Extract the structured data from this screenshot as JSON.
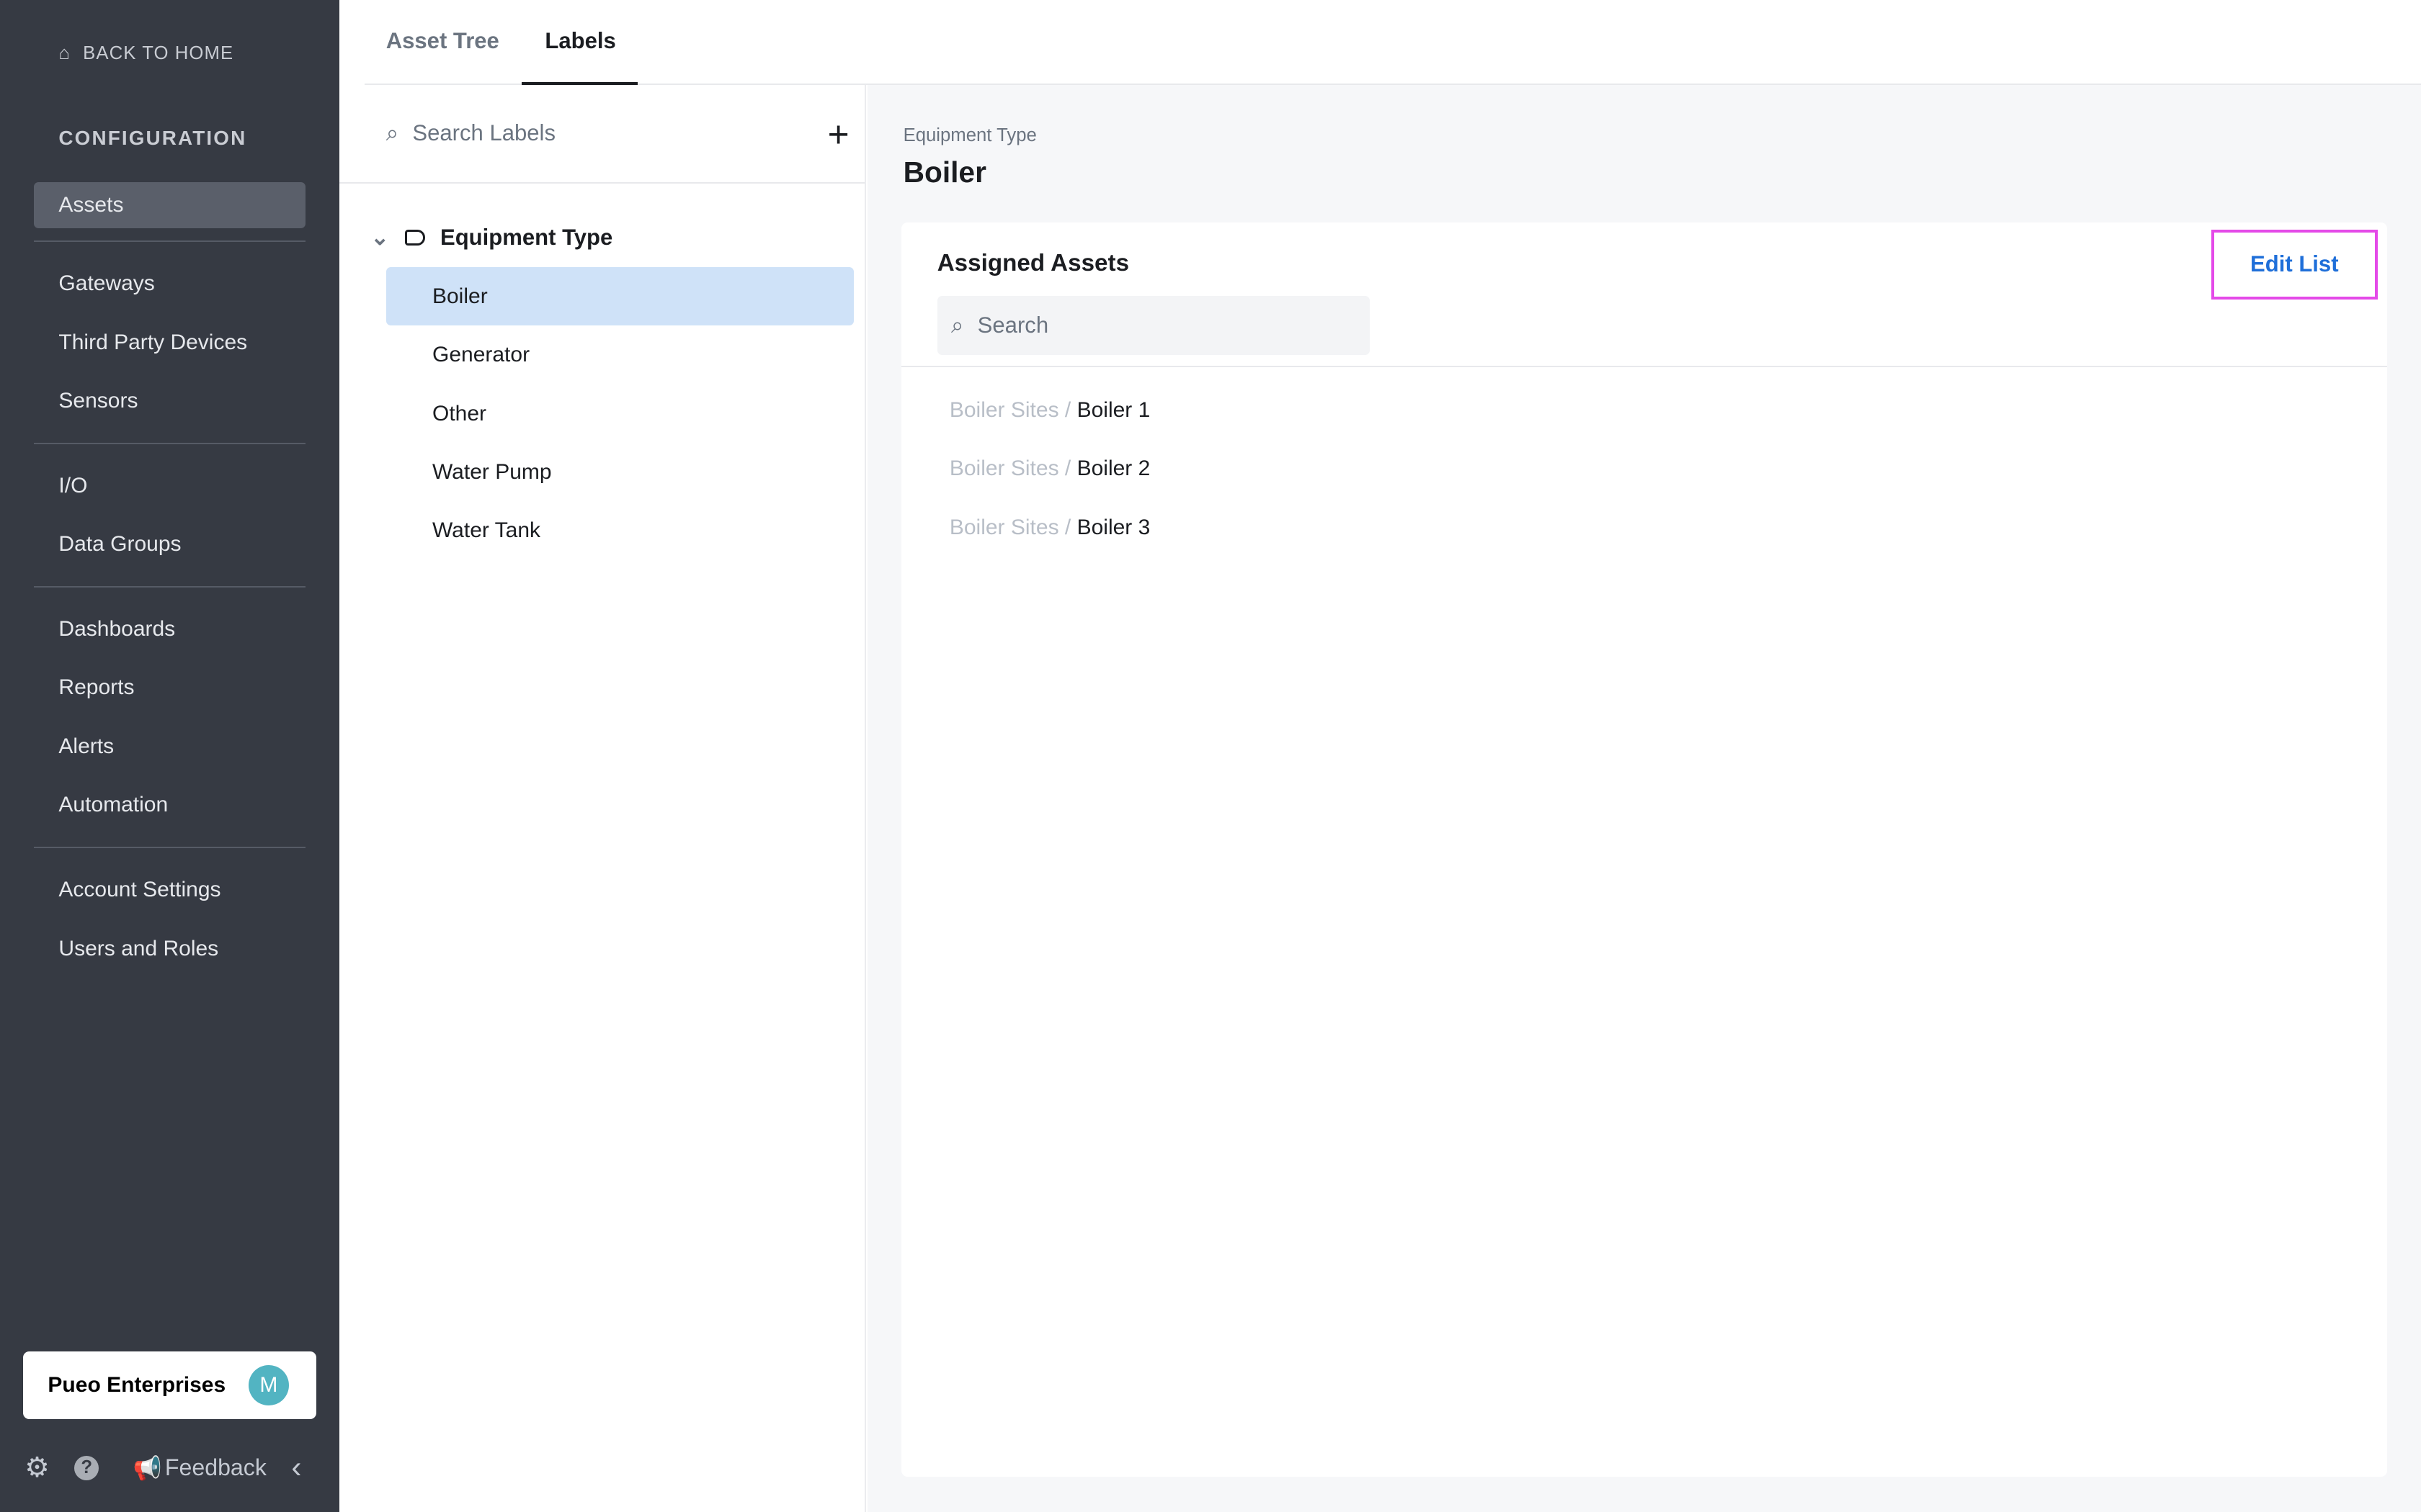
{
  "sidebar": {
    "back": "BACK TO HOME",
    "section": "CONFIGURATION",
    "groups": [
      [
        "Assets"
      ],
      [
        "Gateways",
        "Third Party Devices",
        "Sensors"
      ],
      [
        "I/O",
        "Data Groups"
      ],
      [
        "Dashboards",
        "Reports",
        "Alerts",
        "Automation"
      ],
      [
        "Account Settings",
        "Users and Roles"
      ]
    ],
    "active": "Assets",
    "org": "Pueo Enterprises",
    "avatar": "M",
    "feedback": "Feedback"
  },
  "tabs": [
    {
      "label": "Asset Tree",
      "active": false
    },
    {
      "label": "Labels",
      "active": true
    }
  ],
  "labels": {
    "search_placeholder": "Search Labels",
    "group": "Equipment Type",
    "items": [
      "Boiler",
      "Generator",
      "Other",
      "Water Pump",
      "Water Tank"
    ],
    "selected": "Boiler"
  },
  "detail": {
    "breadcrumb": "Equipment Type",
    "title": "Boiler",
    "card_title": "Assigned Assets",
    "edit": "Edit List",
    "search_placeholder": "Search",
    "assets": [
      {
        "path": "Boiler Sites /",
        "name": "Boiler 1"
      },
      {
        "path": "Boiler Sites /",
        "name": "Boiler 2"
      },
      {
        "path": "Boiler Sites /",
        "name": "Boiler 3"
      }
    ]
  },
  "colors": {
    "sidebar": "#363a43",
    "selected": "#cfe2f8",
    "link": "#1f6fd9",
    "highlight": "#e44ae8",
    "avatar": "#52b4c2"
  }
}
